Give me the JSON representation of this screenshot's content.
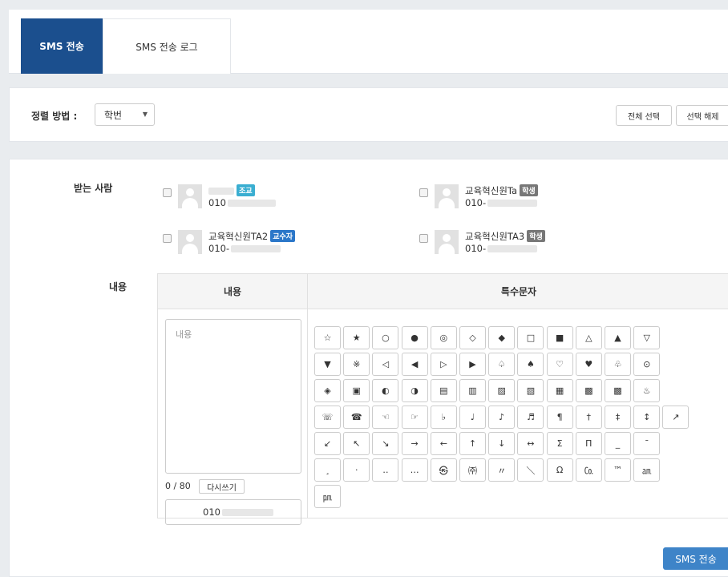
{
  "tabs": [
    {
      "label": "SMS 전송",
      "active": true
    },
    {
      "label": "SMS 전송 로그",
      "active": false
    }
  ],
  "sort": {
    "label": "정렬 방법 :",
    "selected": "학번",
    "select_all": "전체 선택",
    "deselect": "선택 해제"
  },
  "recipients_label": "받는 사람",
  "recipients": [
    {
      "name": "",
      "name_redacted": true,
      "role": "조교",
      "phone_prefix": "010",
      "badge_color": "#3aaed1"
    },
    {
      "name": "교육혁신원Ta",
      "name_redacted": false,
      "role": "학생",
      "phone_prefix": "010-",
      "badge_color": "#777777"
    },
    {
      "name": "교육혁신원TA2",
      "name_redacted": false,
      "role": "교수자",
      "phone_prefix": "010-",
      "badge_color": "#2b77c9"
    },
    {
      "name": "교육혁신원TA3",
      "name_redacted": false,
      "role": "학생",
      "phone_prefix": "010-",
      "badge_color": "#777777"
    }
  ],
  "content": {
    "label": "내용",
    "col_content": "내용",
    "col_special": "특수문자",
    "placeholder": "내용",
    "counter": "0 / 80",
    "rewrite": "다시쓰기",
    "sender_prefix": "010"
  },
  "symbols": [
    [
      "☆",
      "★",
      "○",
      "●",
      "◎",
      "◇",
      "◆",
      "□",
      "■",
      "△",
      "▲",
      "▽"
    ],
    [
      "▼",
      "※",
      "◁",
      "◀",
      "▷",
      "▶",
      "♤",
      "♠",
      "♡",
      "♥",
      "♧",
      "⊙"
    ],
    [
      "◈",
      "▣",
      "◐",
      "◑",
      "▤",
      "▥",
      "▨",
      "▧",
      "▦",
      "▩",
      "▩",
      "♨"
    ],
    [
      "☏",
      "☎",
      "☜",
      "☞",
      "♭",
      "♩",
      "♪",
      "♬",
      "¶",
      "†",
      "‡",
      "↕",
      "↗"
    ],
    [
      "↙",
      "↖",
      "↘",
      "→",
      "←",
      "↑",
      "↓",
      "↔",
      "Σ",
      "Π",
      "_",
      "¯"
    ],
    [
      "¸",
      "·",
      "‥",
      "…",
      "㉿",
      "㈜",
      "〃",
      "＼",
      "Ω",
      "㏇",
      "™",
      "㏂"
    ],
    [
      "㏘"
    ]
  ],
  "send_button": "SMS 전송"
}
